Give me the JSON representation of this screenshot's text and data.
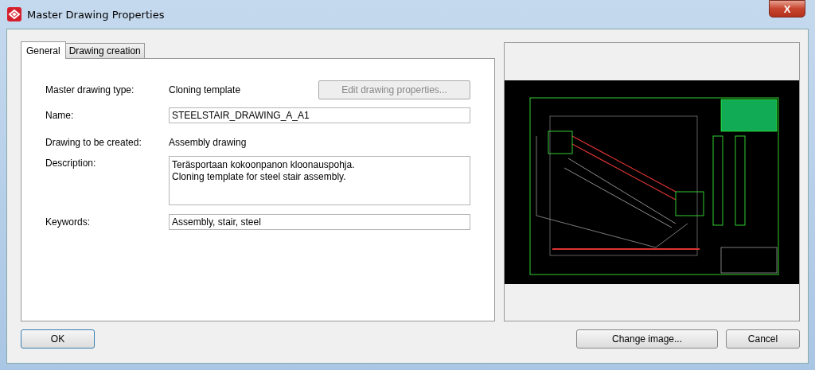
{
  "window": {
    "title": "Master Drawing Properties",
    "close_label": "X"
  },
  "tabs": [
    {
      "label": "General",
      "selected": true
    },
    {
      "label": "Drawing creation",
      "selected": false
    }
  ],
  "form": {
    "type_label": "Master drawing type:",
    "type_value": "Cloning template",
    "edit_button": {
      "label": "Edit drawing properties...",
      "disabled": true
    },
    "name_label": "Name:",
    "name_value": "STEELSTAIR_DRAWING_A_A1",
    "created_label": "Drawing to be created:",
    "created_value": "Assembly drawing",
    "description_label": "Description:",
    "description_lines": [
      "Teräsportaan kokoonpanon kloonauspohja.",
      "Cloning template for steel stair assembly."
    ],
    "keywords_label": "Keywords:",
    "keywords_value": "Assembly, stair, steel"
  },
  "buttons": {
    "ok": "OK",
    "change_image": "Change image...",
    "cancel": "Cancel"
  }
}
